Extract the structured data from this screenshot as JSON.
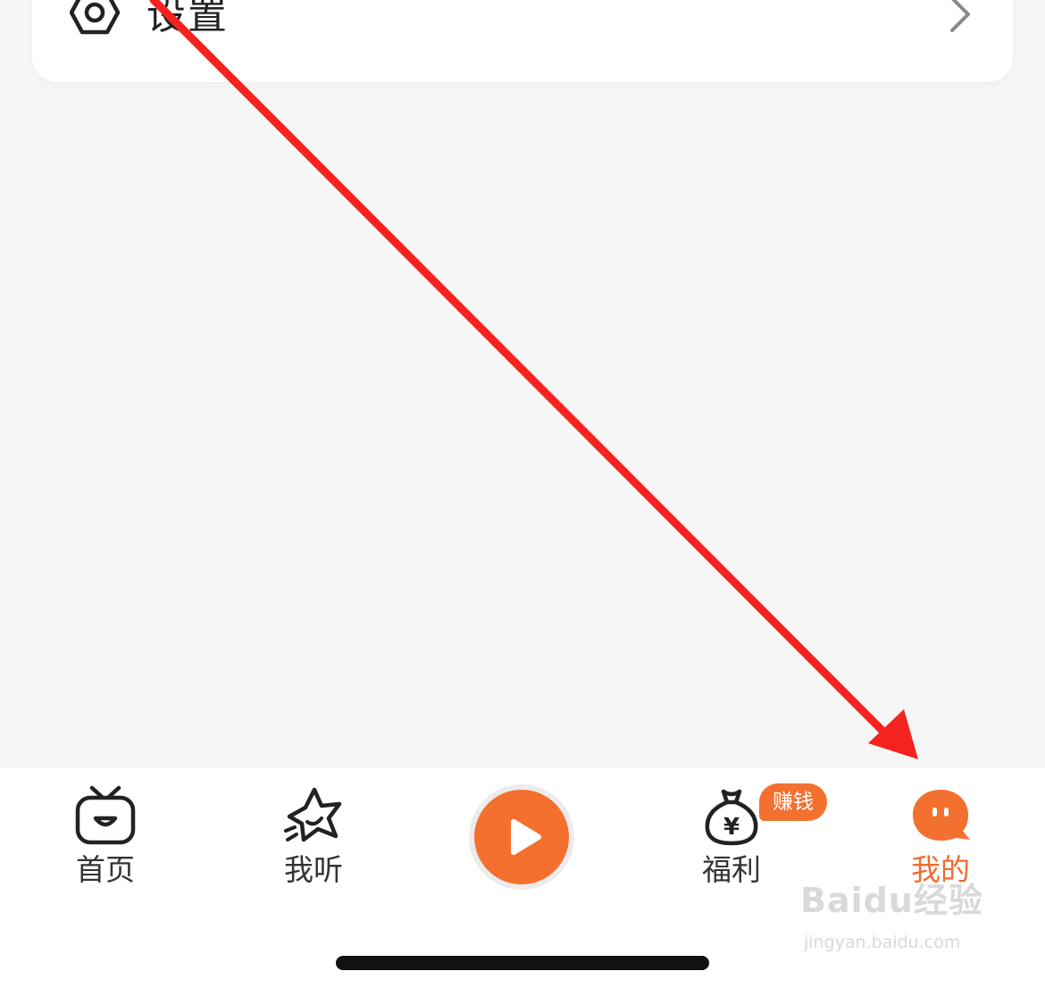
{
  "settings": {
    "label": "设置",
    "icon": "gear-icon",
    "chevron": "chevron-right-icon"
  },
  "tabbar": {
    "tabs": [
      {
        "id": "home",
        "label": "首页",
        "icon": "tv-face-icon",
        "active": false
      },
      {
        "id": "listen",
        "label": "我听",
        "icon": "star-icon",
        "active": false
      },
      {
        "id": "welfare",
        "label": "福利",
        "icon": "money-bag-icon",
        "active": false,
        "badge": "赚钱"
      },
      {
        "id": "mine",
        "label": "我的",
        "icon": "chat-face-icon",
        "active": true
      }
    ],
    "center_button": {
      "icon": "play-icon"
    }
  },
  "watermark": {
    "brand": "Baidu经验",
    "url": "jingyan.baidu.com"
  },
  "colors": {
    "accent": "#f4702f",
    "active_label": "#f26b2f",
    "annotation_arrow": "#f5231f",
    "background": "#f6f6f6"
  }
}
